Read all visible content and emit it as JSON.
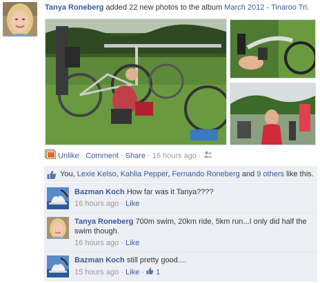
{
  "story": {
    "author": "Tanya Roneberg",
    "action_text": "added 22 new photos to the album",
    "album": "March 2012 - Tinaroo Tri."
  },
  "actions": {
    "unlike": "Unlike",
    "comment": "Comment",
    "share": "Share",
    "timestamp": "16 hours ago"
  },
  "likes": {
    "prefix": "You,",
    "names": [
      "Lexie Kelso",
      "Kahlia Pepper",
      "Fernando Roneberg"
    ],
    "and": "and",
    "others": "9 others",
    "suffix": "like this."
  },
  "comments": [
    {
      "author": "Bazman Koch",
      "text": "How far was it Tanya????",
      "time": "16 hours ago",
      "like": "Like"
    },
    {
      "author": "Tanya Roneberg",
      "text": "700m swim, 20km ride, 5km run...I only did half the swim though.",
      "time": "16 hours ago",
      "like": "Like"
    },
    {
      "author": "Bazman Koch",
      "text": "still pretty good....",
      "time": "15 hours ago",
      "like": "Like",
      "like_count": "1"
    }
  ],
  "colors": {
    "link": "#3b5998",
    "meta": "#999999",
    "box": "#edeff4"
  }
}
